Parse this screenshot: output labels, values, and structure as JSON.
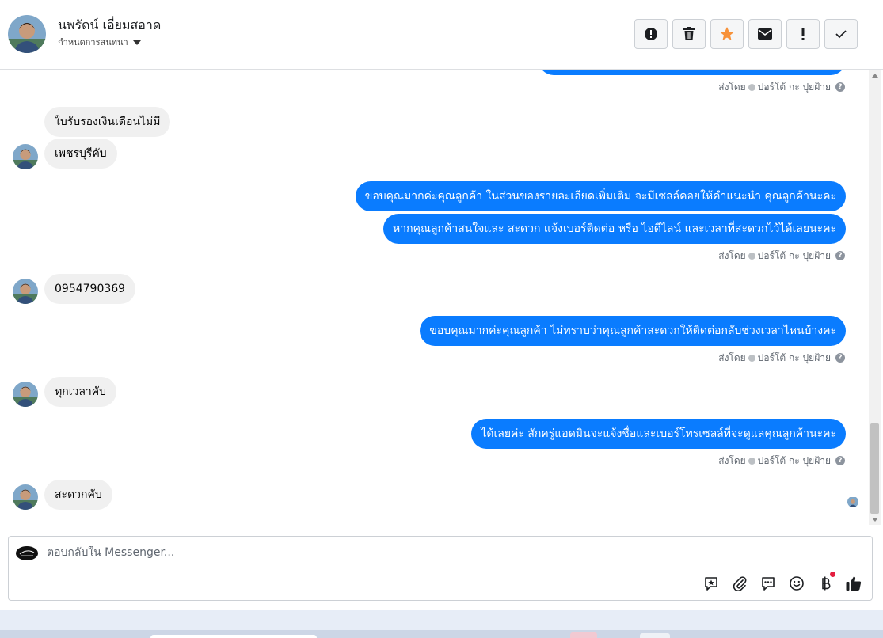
{
  "header": {
    "contact_name": "นพรัดน์ เอี่ยมสอาด",
    "label_action": "กำหนดการสนทนา",
    "actions": [
      {
        "name": "spam",
        "icon": "alert-circle-icon"
      },
      {
        "name": "delete",
        "icon": "trash-icon"
      },
      {
        "name": "star",
        "icon": "star-icon",
        "color": "#f7923a"
      },
      {
        "name": "mark-unread",
        "icon": "envelope-icon"
      },
      {
        "name": "important",
        "icon": "exclamation-icon"
      },
      {
        "name": "done",
        "icon": "checkmark-icon"
      }
    ]
  },
  "thread": {
    "sent_by_label": "ส่งโดย",
    "sender_name": "ปอร์โต้ กะ ปุยฝ้าย",
    "help_glyph": "?",
    "messages": [
      {
        "dir": "in",
        "text": "ใบรับรองเงินเดือนไม่มี"
      },
      {
        "dir": "in",
        "text": "เพชรบุรีคับ"
      },
      {
        "dir": "out",
        "text": "ขอบคุณมากค่ะคุณลูกค้า  ในส่วนของรายละเอียดเพิ่มเติม จะมีเซลล์คอยให้คำแนะนำ คุณลูกค้านะคะ"
      },
      {
        "dir": "out",
        "text": "หากคุณลูกค้าสนใจและ สะดวก แจ้งเบอร์ติดต่อ หรือ ไอดีไลน์ และเวลาที่สะดวกไว้ได้เลยนะคะ"
      },
      {
        "dir": "in",
        "text": "0954790369"
      },
      {
        "dir": "out",
        "text": "ขอบคุณมากค่ะคุณลูกค้า ไม่ทราบว่าคุณลูกค้าสะดวกให้ติดต่อกลับช่วงเวลาไหนบ้างคะ"
      },
      {
        "dir": "in",
        "text": "ทุกเวลาคับ"
      },
      {
        "dir": "out",
        "text": "ได้เลยค่ะ สักครู่แอดมินจะแจ้งชื่อและเบอร์โทรเซลล์ที่จะดูแลคุณลูกค้านะคะ"
      },
      {
        "dir": "in",
        "text": "สะดวกคับ"
      }
    ]
  },
  "composer": {
    "placeholder": "ตอบกลับใน Messenger...",
    "tools": [
      "saved-reply-icon",
      "attachment-icon",
      "chat-bubble-icon",
      "emoji-icon",
      "baht-payment-icon",
      "like-icon"
    ]
  },
  "colors": {
    "outgoing_bubble": "#0a7cff",
    "incoming_bubble": "#f0f0f0",
    "star": "#f7923a",
    "notification_dot": "#e41e3f"
  }
}
